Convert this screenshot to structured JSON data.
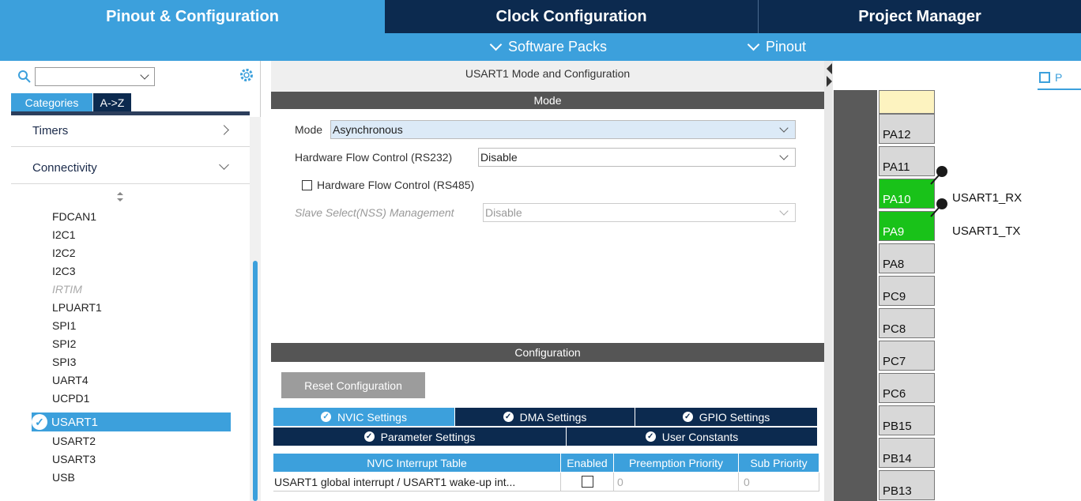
{
  "top_tabs": {
    "pinout": "Pinout & Configuration",
    "clock": "Clock Configuration",
    "project": "Project Manager"
  },
  "sub_menu": {
    "software_packs": "Software Packs",
    "pinout": "Pinout"
  },
  "left": {
    "search_value": "",
    "tab_categories": "Categories",
    "tab_az": "A->Z",
    "timers": "Timers",
    "connectivity": "Connectivity",
    "peripherals": [
      "FDCAN1",
      "I2C1",
      "I2C2",
      "I2C3",
      "IRTIM",
      "LPUART1",
      "SPI1",
      "SPI2",
      "SPI3",
      "UART4",
      "UCPD1"
    ],
    "selected": "USART1",
    "after_selected": [
      "USART2",
      "USART3",
      "USB"
    ]
  },
  "middle": {
    "title": "USART1 Mode and Configuration",
    "mode_header": "Mode",
    "mode_label": "Mode",
    "mode_value": "Asynchronous",
    "hfc232_label": "Hardware Flow Control (RS232)",
    "hfc232_value": "Disable",
    "hfc485_label": "Hardware Flow Control (RS485)",
    "nss_label": "Slave Select(NSS) Management",
    "nss_value": "Disable",
    "config_header": "Configuration",
    "reset_button": "Reset Configuration",
    "tabs": {
      "nvic": "NVIC Settings",
      "dma": "DMA Settings",
      "gpio": "GPIO Settings",
      "param": "Parameter Settings",
      "user": "User Constants"
    },
    "table": {
      "headers": [
        "NVIC Interrupt Table",
        "Enabled",
        "Preemption Priority",
        "Sub Priority"
      ],
      "row": {
        "name": "USART1 global interrupt / USART1 wake-up int...",
        "preempt": "0",
        "sub": "0"
      }
    }
  },
  "right": {
    "tab_label": "P",
    "pins": [
      "PA12",
      "PA11",
      "PA10",
      "PA9",
      "PA8",
      "PC9",
      "PC8",
      "PC7",
      "PC6",
      "PB15",
      "PB14",
      "PB13"
    ],
    "pa10_signal": "USART1_RX",
    "pa9_signal": "USART1_TX"
  },
  "colors": {
    "accent": "#3ca0dc",
    "navy": "#0c2a4f",
    "pin_green": "#19c219"
  }
}
